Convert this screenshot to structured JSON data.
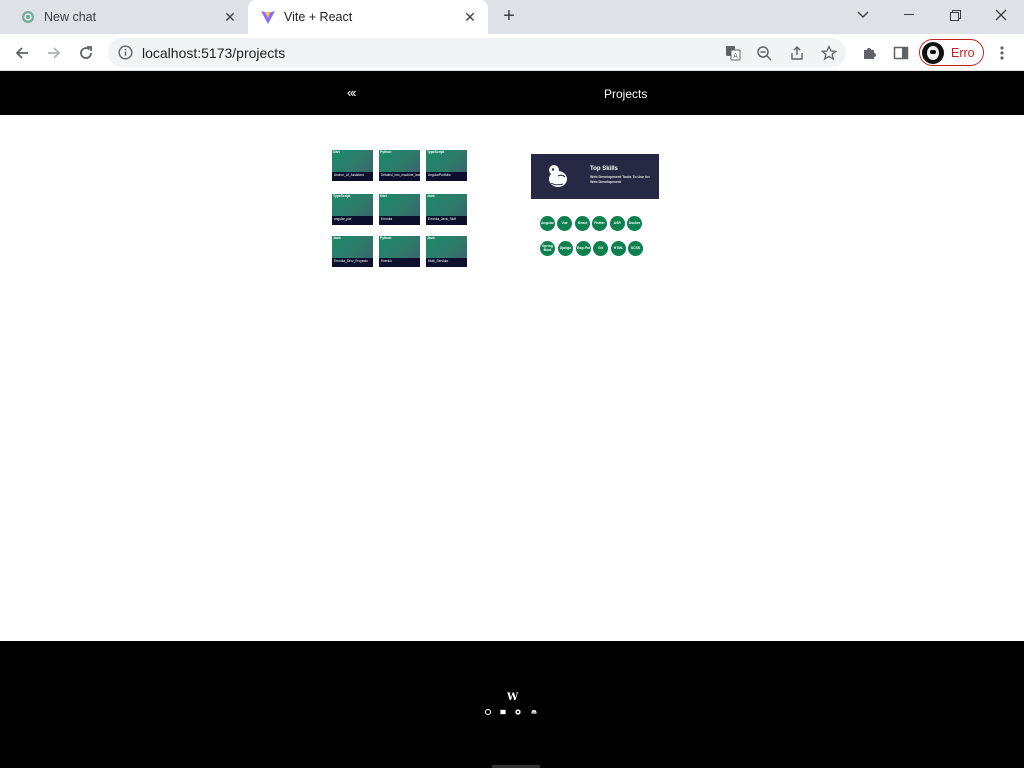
{
  "browser": {
    "tabs": [
      {
        "title": "New chat",
        "favicon": "openai-icon",
        "active": false
      },
      {
        "title": "Vite + React",
        "favicon": "vite-icon",
        "active": true
      }
    ],
    "url": "localhost:5173/projects",
    "profile_label": "Erro",
    "accent_color": "#c5221f"
  },
  "appbar": {
    "back_label": "«‹",
    "title": "Projects"
  },
  "projects": [
    {
      "lang": "Dart",
      "name": "Anchor_AI_Assistant"
    },
    {
      "lang": "Python",
      "name": "Detailed_into_machine_leaning_assistant"
    },
    {
      "lang": "TypeScript",
      "name": "AngularPortfolio"
    },
    {
      "lang": "TypeScript",
      "name": "angular_pwr"
    },
    {
      "lang": "Dart",
      "name": "Erronka"
    },
    {
      "lang": "Java",
      "name": "Erronka_Java_Stuff"
    },
    {
      "lang": "Java",
      "name": "Erronka_Serv_Proyecto"
    },
    {
      "lang": "Python",
      "name": "Enerlux"
    },
    {
      "lang": "Java",
      "name": "Multi_Servidor"
    }
  ],
  "skills_banner": {
    "title": "Top Skills",
    "subtitle": "Web Development Tools To Use for Web Development"
  },
  "skills": [
    "Angular",
    "Vue",
    "React",
    "Flutter",
    "ASP.",
    "Docker",
    "Spring Boot",
    "Django",
    "Bop-Pal",
    "Git",
    "HTML",
    "SCSS"
  ],
  "footer": {
    "brand": "W",
    "social_icons": [
      "linkedin-icon",
      "mail-icon",
      "github-icon",
      "discord-icon"
    ]
  },
  "colors": {
    "header_bg": "#000000",
    "card_gradient_start": "#1a8a67",
    "card_footer": "#0c0f2e",
    "skill_green": "#0d8050",
    "banner_bg": "#272944"
  }
}
